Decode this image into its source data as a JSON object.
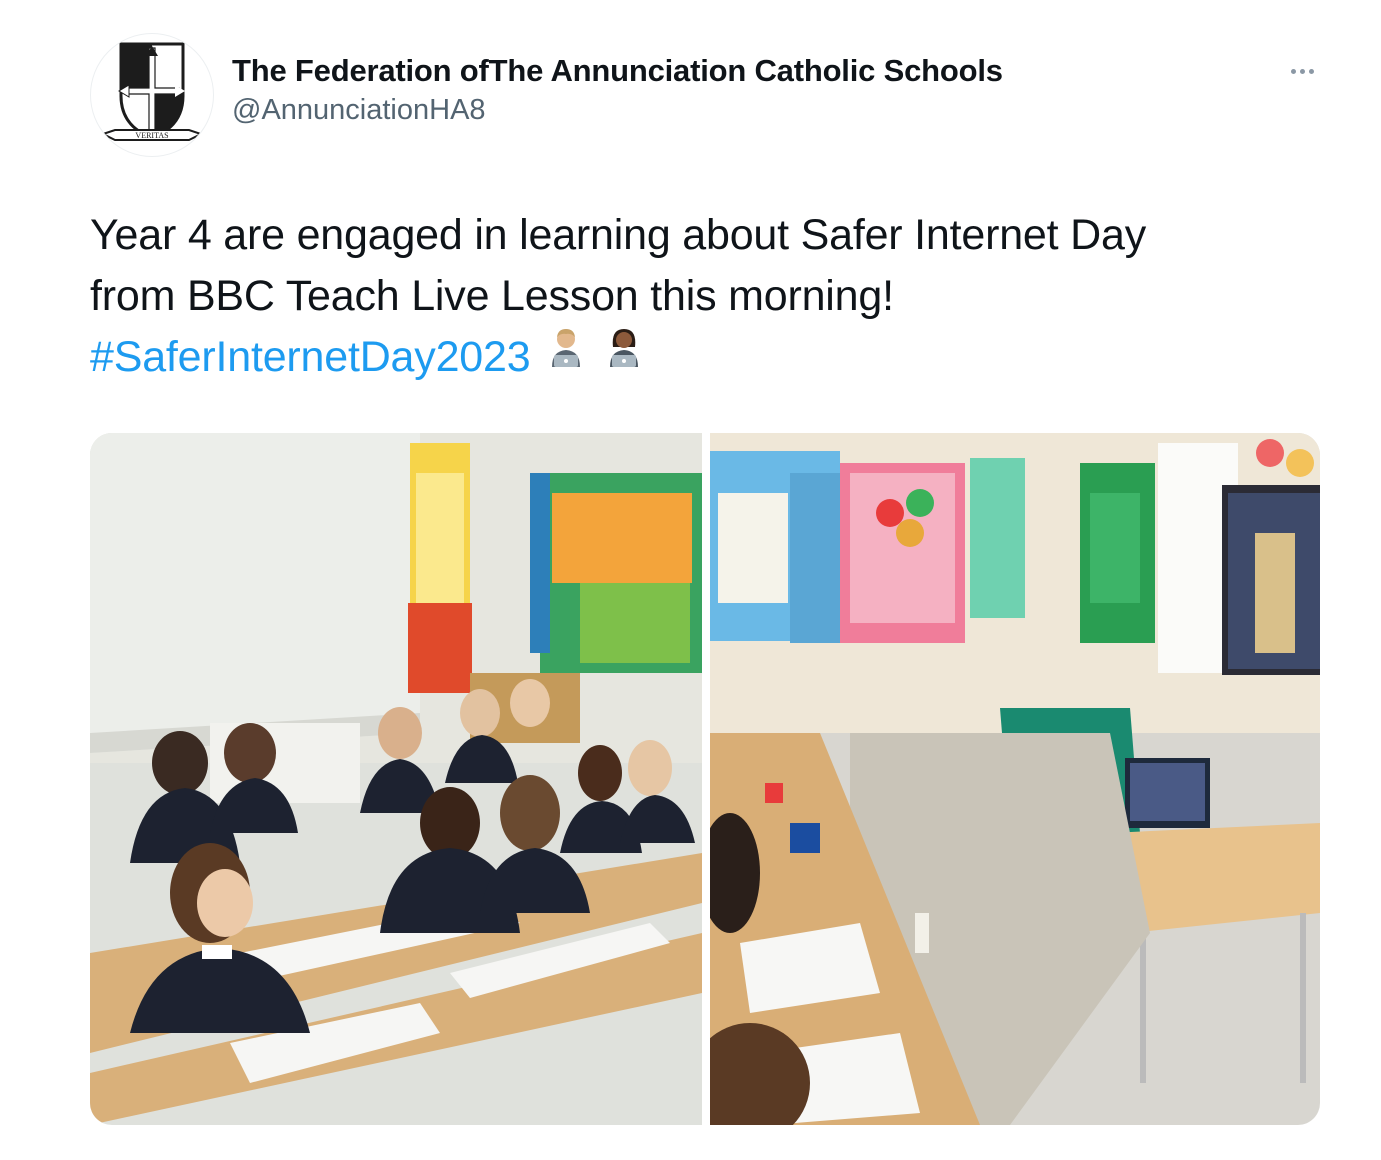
{
  "author": {
    "display_name": "The Federation ofThe Annunciation Catholic Schools",
    "handle": "@AnnunciationHA8",
    "avatar_motto": "VERITAS"
  },
  "more_icon": "more-horizontal-icon",
  "tweet": {
    "line1": "Year 4 are engaged in learning about Safer Internet Day",
    "line2": "from BBC Teach Live Lesson this morning!",
    "hashtag": "#SaferInternetDay2023",
    "emojis": [
      "man-technologist-medium-light-skin",
      "woman-technologist-medium-dark-skin"
    ]
  },
  "colors": {
    "link": "#1d9bf0",
    "secondary_text": "#536471",
    "primary_text": "#0f1419"
  },
  "media": {
    "photo_1": "Pupils in school uniform seated at desks facing the front of a classroom",
    "photo_2": "Classroom with display boards, laptop and interactive screen showing a live lesson"
  }
}
